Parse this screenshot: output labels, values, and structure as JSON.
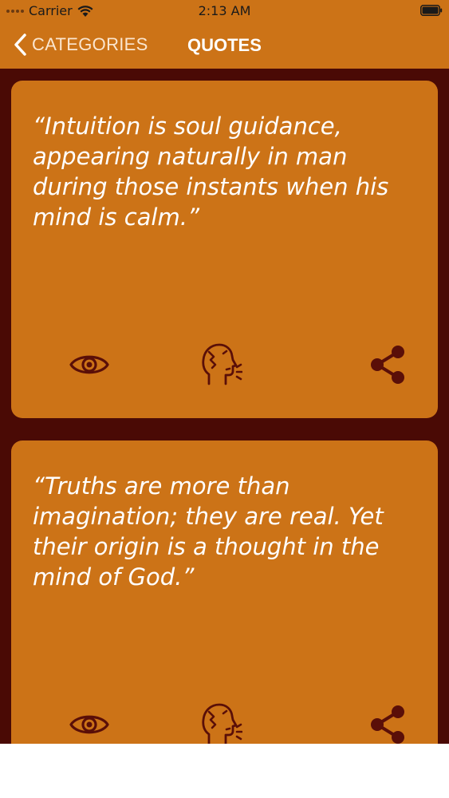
{
  "status_bar": {
    "carrier": "Carrier",
    "time": "2:13 AM"
  },
  "nav": {
    "back_label": "CATEGORIES",
    "title": "QUOTES"
  },
  "quotes": [
    {
      "text": "“Intuition is soul guidance, appearing naturally in man during those instants when his mind is calm.”"
    },
    {
      "text": "“Truths are more than imagination; they are real. Yet their origin is a thought in the mind of God.”"
    }
  ],
  "icons": {
    "view": "eye-icon",
    "speak": "speaking-head-icon",
    "share": "share-icon"
  },
  "colors": {
    "accent": "#cc7317",
    "background": "#4a0a05",
    "icon": "#5a0f08"
  }
}
